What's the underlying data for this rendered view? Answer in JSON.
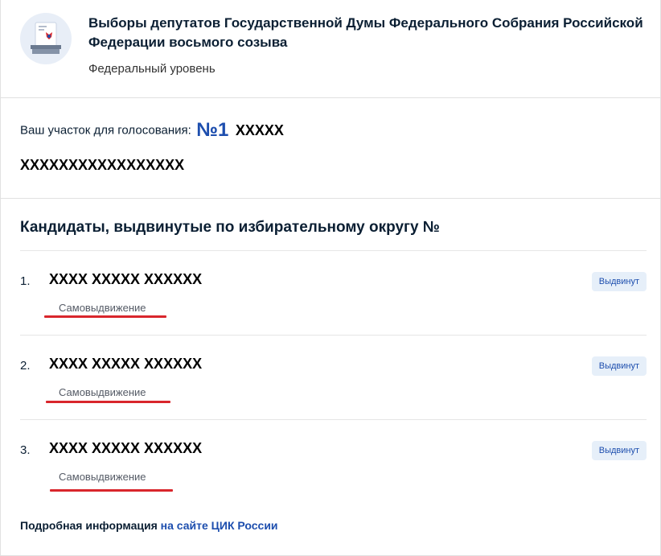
{
  "header": {
    "title": "Выборы депутатов Государственной Думы Федерального Собрания Российской Федерации восьмого созыва",
    "level": "Федеральный уровень"
  },
  "station": {
    "label": "Ваш участок для голосования:",
    "number": "№1",
    "name_line1": "ХХХХХ",
    "name_line2": "ХХХХХХХХХХХХХХХХХ"
  },
  "candidates": {
    "title": "Кандидаты, выдвинутые по избирательному округу №",
    "items": [
      {
        "num": "1.",
        "name": "ХХХХ ХХХХХ ХХХХХХ",
        "party": "Самовыдвижение",
        "status": "Выдвинут"
      },
      {
        "num": "2.",
        "name": "ХХХХ ХХХХХ ХХХХХХ",
        "party": "Самовыдвижение",
        "status": "Выдвинут"
      },
      {
        "num": "3.",
        "name": "ХХХХ ХХХХХ ХХХХХХ",
        "party": "Самовыдвижение",
        "status": "Выдвинут"
      }
    ]
  },
  "footer": {
    "more_label": "Подробная информация",
    "more_link": "на сайте ЦИК России"
  },
  "colors": {
    "accent": "#1d4eae",
    "badge_bg": "#e6eff9",
    "underline": "#d9262c"
  }
}
